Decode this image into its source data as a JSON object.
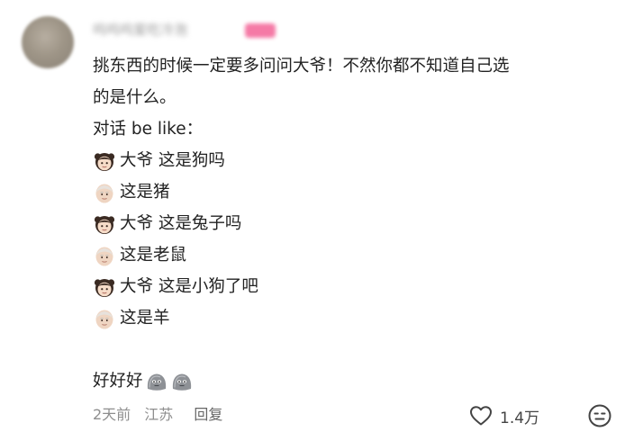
{
  "comment": {
    "username": "呜呜呜爱吃冷泡",
    "paragraphs": [
      "挑东西的时候一定要多问问大爷！不然你都不知道自己选",
      "的是什么。",
      "对话 be like："
    ],
    "dialog": [
      {
        "speaker": "girl",
        "text": "大爷 这是狗吗"
      },
      {
        "speaker": "old-man",
        "text": "这是猪"
      },
      {
        "speaker": "girl",
        "text": "大爷 这是兔子吗"
      },
      {
        "speaker": "old-man",
        "text": "这是老鼠"
      },
      {
        "speaker": "girl",
        "text": "大爷 这是小狗了吧"
      },
      {
        "speaker": "old-man",
        "text": "这是羊"
      }
    ],
    "ending": "好好好",
    "meta": {
      "time": "2天前",
      "location": "江苏",
      "reply_label": "回复"
    },
    "likes_count": "1.4万"
  },
  "icons": {
    "avatar": "avatar-image",
    "speaker_girl": "girl-emoji-icon",
    "speaker_old_man": "old-man-emoji-icon",
    "ending_emoji": "rock-emoji-icon",
    "like": "heart-outline-icon",
    "more": "expressionless-face-icon"
  },
  "colors": {
    "badge": "#f57aa6",
    "text": "#222222",
    "meta": "#8e8e8e"
  }
}
